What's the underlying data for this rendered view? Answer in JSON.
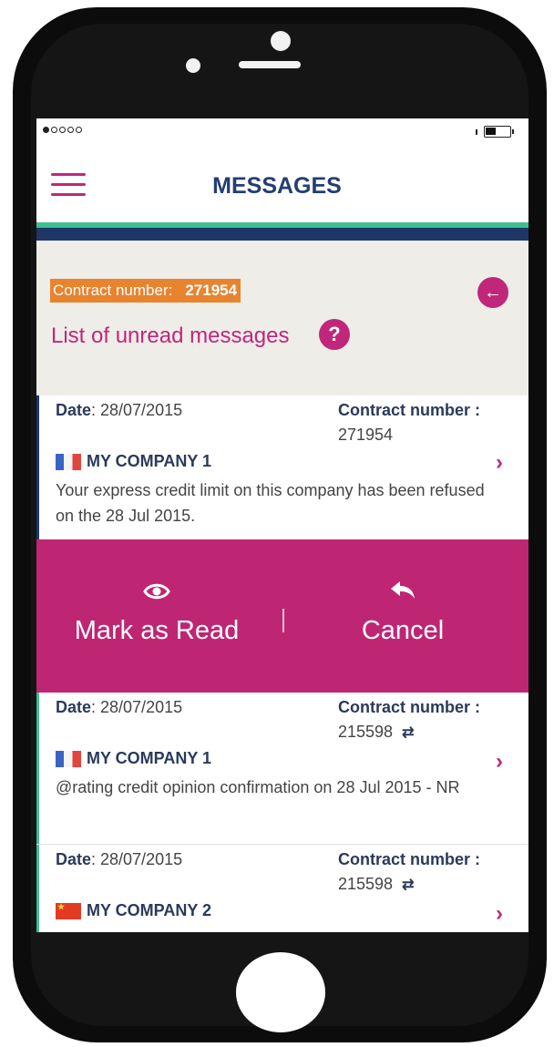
{
  "header": {
    "title": "MESSAGES"
  },
  "panel": {
    "contract_label": "Contract number:",
    "contract_number": "271954",
    "list_title": "List of unread messages",
    "help_glyph": "?"
  },
  "messages": [
    {
      "date_label": "Date",
      "date": ": 28/07/2015",
      "contract_label": "Contract number :",
      "contract_number": "271954",
      "has_swap_icon": false,
      "flag": "flag-france-icon",
      "company": "MY COMPANY 1",
      "text": "Your express credit limit on this company has been refused on the 28 Jul 2015."
    },
    {
      "date_label": "Date",
      "date": ": 28/07/2015",
      "contract_label": "Contract number :",
      "contract_number": "215598",
      "has_swap_icon": true,
      "flag": "flag-france-icon",
      "company": "MY COMPANY 1",
      "text": "@rating credit opinion confirmation on 28 Jul 2015 - NR"
    },
    {
      "date_label": "Date",
      "date": ": 28/07/2015",
      "contract_label": "Contract number :",
      "contract_number": "215598",
      "has_swap_icon": true,
      "flag": "flag-china-icon",
      "company": "MY COMPANY 2",
      "text": ""
    }
  ],
  "actions": {
    "mark_read": "Mark as Read",
    "cancel": "Cancel"
  },
  "colors": {
    "accent": "#be2673",
    "navy": "#1f3767",
    "green": "#3fbf8f",
    "highlight": "#e8832e"
  }
}
